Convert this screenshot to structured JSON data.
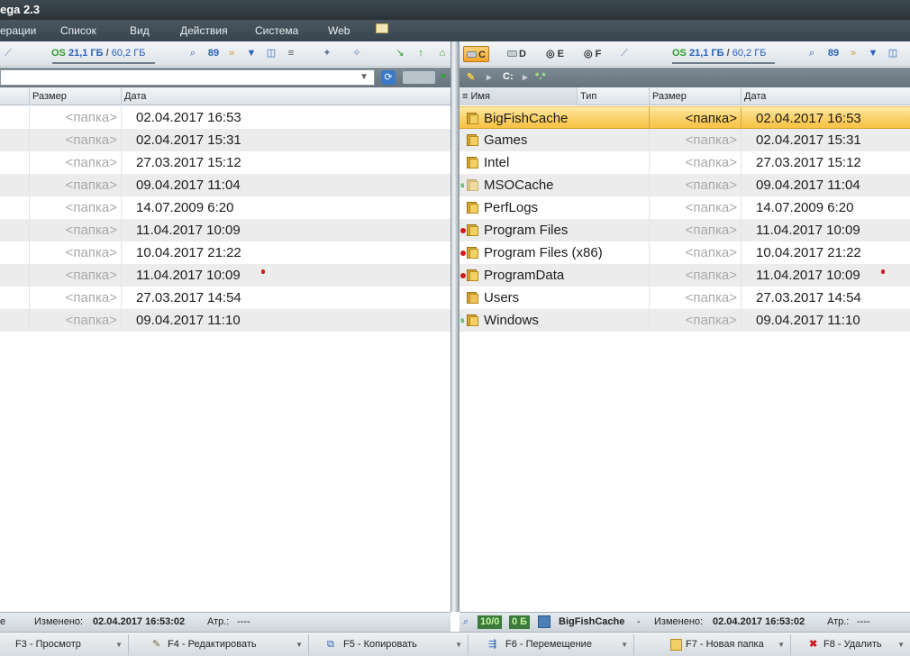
{
  "window": {
    "title": "ega 2.3"
  },
  "menu": [
    "ерации",
    "Список",
    "Вид",
    "Действия",
    "Система",
    "Web"
  ],
  "left_panel": {
    "free_space": {
      "label": "OS",
      "used": "21,1 ГБ",
      "separator": "/",
      "total": "60,2 ГБ"
    },
    "toolbar_icons": [
      "search-icon",
      "grid-89-icon",
      "double-arrow-icon",
      "filter-icon",
      "view-icon",
      "list-icon",
      "tools-icon",
      "green-arrow-icon",
      "home-icon"
    ],
    "columns": {
      "size": "Размер",
      "date": "Дата"
    },
    "rows": [
      {
        "size": "<папка>",
        "date": "02.04.2017 16:53"
      },
      {
        "size": "<папка>",
        "date": "02.04.2017 15:31"
      },
      {
        "size": "<папка>",
        "date": "27.03.2017 15:12"
      },
      {
        "size": "<папка>",
        "date": "09.04.2017 11:04"
      },
      {
        "size": "<папка>",
        "date": "14.07.2009 6:20"
      },
      {
        "size": "<папка>",
        "date": "11.04.2017 10:09"
      },
      {
        "size": "<папка>",
        "date": "10.04.2017 21:22"
      },
      {
        "size": "<папка>",
        "date": "11.04.2017 10:09"
      },
      {
        "size": "<папка>",
        "date": "27.03.2017 14:54"
      },
      {
        "size": "<папка>",
        "date": "09.04.2017 11:10"
      }
    ],
    "status": {
      "text1": "е",
      "modified_label": "Изменено:",
      "modified_value": "02.04.2017 16:53:02",
      "attr_label": "Атр.:",
      "attr_value": "----"
    }
  },
  "right_panel": {
    "drives": [
      {
        "letter": "C",
        "active": true
      },
      {
        "letter": "D",
        "active": false
      },
      {
        "letter": "E",
        "active": false
      },
      {
        "letter": "F",
        "active": false
      }
    ],
    "free_space": {
      "label": "OS",
      "used": "21,1 ГБ",
      "separator": "/",
      "total": "60,2 ГБ"
    },
    "path": {
      "drive": "C:",
      "mask": "*.*"
    },
    "columns": {
      "name": "Имя",
      "type": "Тип",
      "size": "Размер",
      "date": "Дата"
    },
    "rows": [
      {
        "name": "BigFishCache",
        "size": "<папка>",
        "date": "02.04.2017 16:53",
        "selected": true,
        "marker": ""
      },
      {
        "name": "Games",
        "size": "<папка>",
        "date": "02.04.2017 15:31",
        "marker": ""
      },
      {
        "name": "Intel",
        "size": "<папка>",
        "date": "27.03.2017 15:12",
        "marker": ""
      },
      {
        "name": "MSOCache",
        "size": "<папка>",
        "date": "09.04.2017 11:04",
        "marker": "green"
      },
      {
        "name": "PerfLogs",
        "size": "<папка>",
        "date": "14.07.2009 6:20",
        "marker": ""
      },
      {
        "name": "Program Files",
        "size": "<папка>",
        "date": "11.04.2017 10:09",
        "marker": "red"
      },
      {
        "name": "Program Files (x86)",
        "size": "<папка>",
        "date": "10.04.2017 21:22",
        "marker": "red"
      },
      {
        "name": "ProgramData",
        "size": "<папка>",
        "date": "11.04.2017 10:09",
        "marker": "red"
      },
      {
        "name": "Users",
        "size": "<папка>",
        "date": "27.03.2017 14:54",
        "marker": ""
      },
      {
        "name": "Windows",
        "size": "<папка>",
        "date": "09.04.2017 11:10",
        "marker": "green"
      }
    ],
    "status": {
      "counter1": "10/0",
      "counter2": "0 Б",
      "name": "BigFishCache",
      "dash": "-",
      "modified_label": "Изменено:",
      "modified_value": "02.04.2017 16:53:02",
      "attr_label": "Атр.:",
      "attr_value": "----"
    }
  },
  "function_keys": [
    {
      "label": "F3 - Просмотр"
    },
    {
      "label": "F4 - Редактировать"
    },
    {
      "label": "F5 - Копировать"
    },
    {
      "label": "F6 - Перемещение"
    },
    {
      "label": "F7 - Новая папка"
    },
    {
      "label": "F8 - Удалить"
    }
  ],
  "colors": {
    "selection": "#fbd36b",
    "accent_blue": "#2a62b8",
    "free_green": "#2e9a2e",
    "marker_red": "#d01c1c"
  }
}
